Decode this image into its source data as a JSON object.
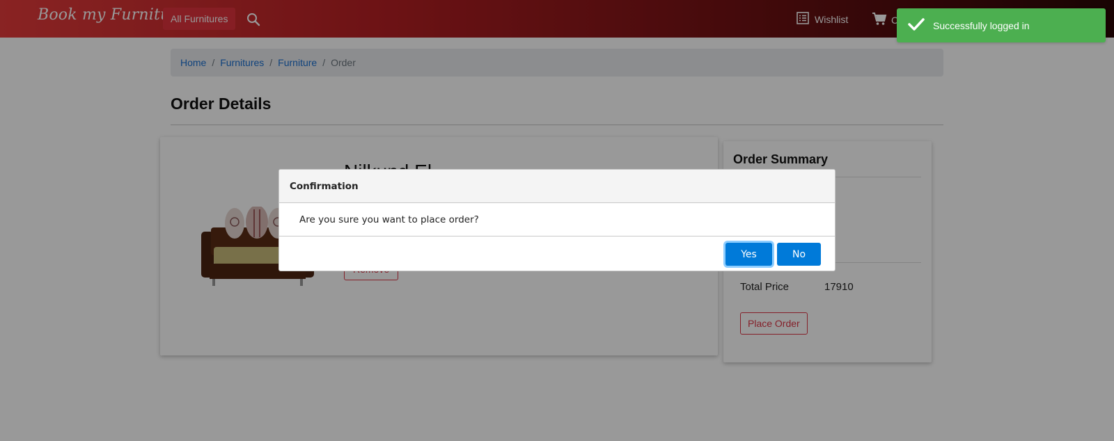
{
  "navbar": {
    "brand": "Book my Furniture",
    "all_furnitures_label": "All Furnitures",
    "wishlist_label": "Wishlist",
    "cart_label": "C"
  },
  "breadcrumb": {
    "items": [
      "Home",
      "Furnitures",
      "Furniture"
    ],
    "active": "Order",
    "separator": "/"
  },
  "page": {
    "title": "Order Details"
  },
  "item": {
    "name": "Nilkund El",
    "remove_label": "Remove"
  },
  "summary": {
    "title": "Order Summary",
    "total_label": "Total Price",
    "total_value": "17910",
    "place_order_label": "Place Order"
  },
  "dialog": {
    "title": "Confirmation",
    "message": "Are you sure you want to place order?",
    "yes_label": "Yes",
    "no_label": "No"
  },
  "toast": {
    "message": "Successfully logged in"
  },
  "colors": {
    "accent_blue": "#007ad9",
    "danger_red": "#dc3545",
    "toast_green": "#4caf50",
    "brand_red": "#e53b3b"
  }
}
